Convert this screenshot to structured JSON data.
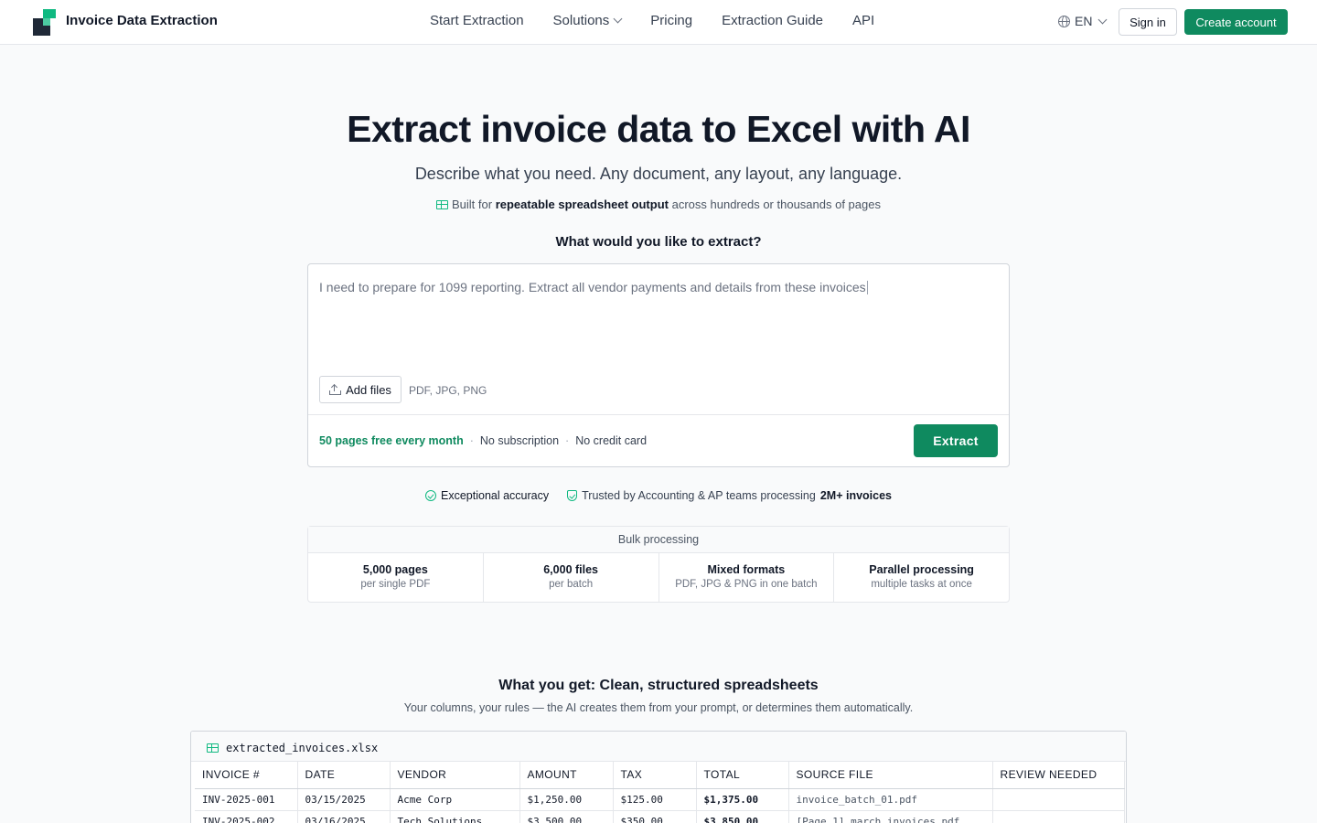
{
  "header": {
    "brand": "Invoice Data Extraction",
    "nav": [
      {
        "label": "Start Extraction"
      },
      {
        "label": "Solutions"
      },
      {
        "label": "Pricing"
      },
      {
        "label": "Extraction Guide"
      },
      {
        "label": "API"
      }
    ],
    "language": "EN",
    "signin_label": "Sign in",
    "create_label": "Create account",
    "colors": {
      "brand": "#0f8a5f",
      "accent": "#10b981",
      "logo_dark": "#1f2937"
    }
  },
  "hero": {
    "title": "Extract invoice data to Excel with AI",
    "subtitle": "Describe what you need. Any document, any layout, any language.",
    "built_prefix": "Built for",
    "built_bold": "repeatable spreadsheet output",
    "built_suffix": "across hundreds or thousands of pages",
    "question": "What would you like to extract?"
  },
  "prompt": {
    "text": "I need to prepare for 1099 reporting. Extract all vendor payments and details from these invoices",
    "add_files_label": "Add files",
    "formats": "PDF, JPG, PNG",
    "free_pages": "50 pages free every month",
    "no_subscription": "No subscription",
    "no_credit_card": "No credit card",
    "separator": "·",
    "extract_label": "Extract"
  },
  "trust": {
    "accuracy": "Exceptional accuracy",
    "trusted_prefix": "Trusted by Accounting & AP teams processing",
    "trusted_bold": "2M+ invoices"
  },
  "bulk": {
    "title": "Bulk processing",
    "items": [
      {
        "main": "5,000 pages",
        "sub": "per single PDF"
      },
      {
        "main": "6,000 files",
        "sub": "per batch"
      },
      {
        "main": "Mixed formats",
        "sub": "PDF, JPG & PNG in one batch"
      },
      {
        "main": "Parallel processing",
        "sub": "multiple tasks at once"
      }
    ]
  },
  "output": {
    "title": "What you get: Clean, structured spreadsheets",
    "subtitle": "Your columns, your rules — the AI creates them from your prompt, or determines them automatically.",
    "filename": "extracted_invoices.xlsx",
    "columns": [
      "INVOICE #",
      "DATE",
      "VENDOR",
      "AMOUNT",
      "TAX",
      "TOTAL",
      "SOURCE FILE",
      "REVIEW NEEDED"
    ],
    "rows": [
      [
        "INV-2025-001",
        "03/15/2025",
        "Acme Corp",
        "$1,250.00",
        "$125.00",
        "$1,375.00",
        "invoice_batch_01.pdf",
        ""
      ],
      [
        "INV-2025-002",
        "03/16/2025",
        "Tech Solutions",
        "$3,500.00",
        "$350.00",
        "$3,850.00",
        "[Page 1] march_invoices.pdf",
        ""
      ]
    ]
  }
}
